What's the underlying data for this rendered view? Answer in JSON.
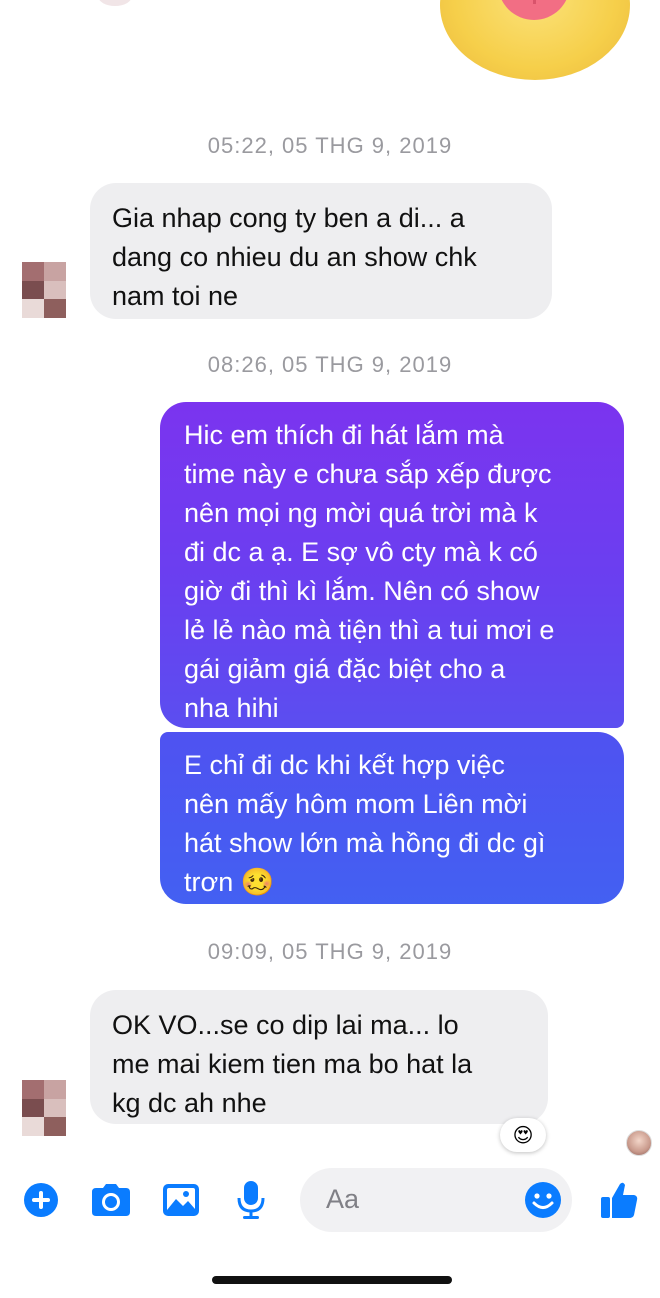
{
  "messages": {
    "ts1": "05:22, 05 THG 9, 2019",
    "in1": [
      "Gia nhap cong ty ben a di... a",
      "dang co nhieu du an show chk",
      "nam toi ne"
    ],
    "ts2": "08:26, 05 THG 9, 2019",
    "out1": [
      "Hic em thích đi hát lắm mà",
      "time này e chưa sắp xếp được",
      "nên mọi ng mời quá trời mà k",
      "đi dc a ạ. E sợ vô cty mà k có",
      "giờ đi thì kì lắm. Nên có show",
      "lẻ lẻ nào mà tiện thì a tui mơi e",
      "gái giảm giá đặc biệt cho a",
      "nha hihi"
    ],
    "out2": [
      "E chỉ đi dc khi kết hợp việc",
      "nên mấy hôm mom Liên mời",
      "hát show lớn mà hồng đi dc gì",
      "trơn"
    ],
    "ts3": "09:09, 05 THG 9, 2019",
    "in2": [
      "OK VO...se co dip lai ma... lo",
      "me mai kiem tien ma bo hat la",
      "kg dc ah nhe"
    ],
    "reaction": "😍",
    "out2_emoji": "🥴"
  },
  "composer": {
    "placeholder": "Aa"
  },
  "colors": {
    "accent": "#0a7cff",
    "bubble_in": "#eeeef0",
    "bubble_out_top": "#7b34ef",
    "bubble_out_bottom": "#4360f2"
  }
}
